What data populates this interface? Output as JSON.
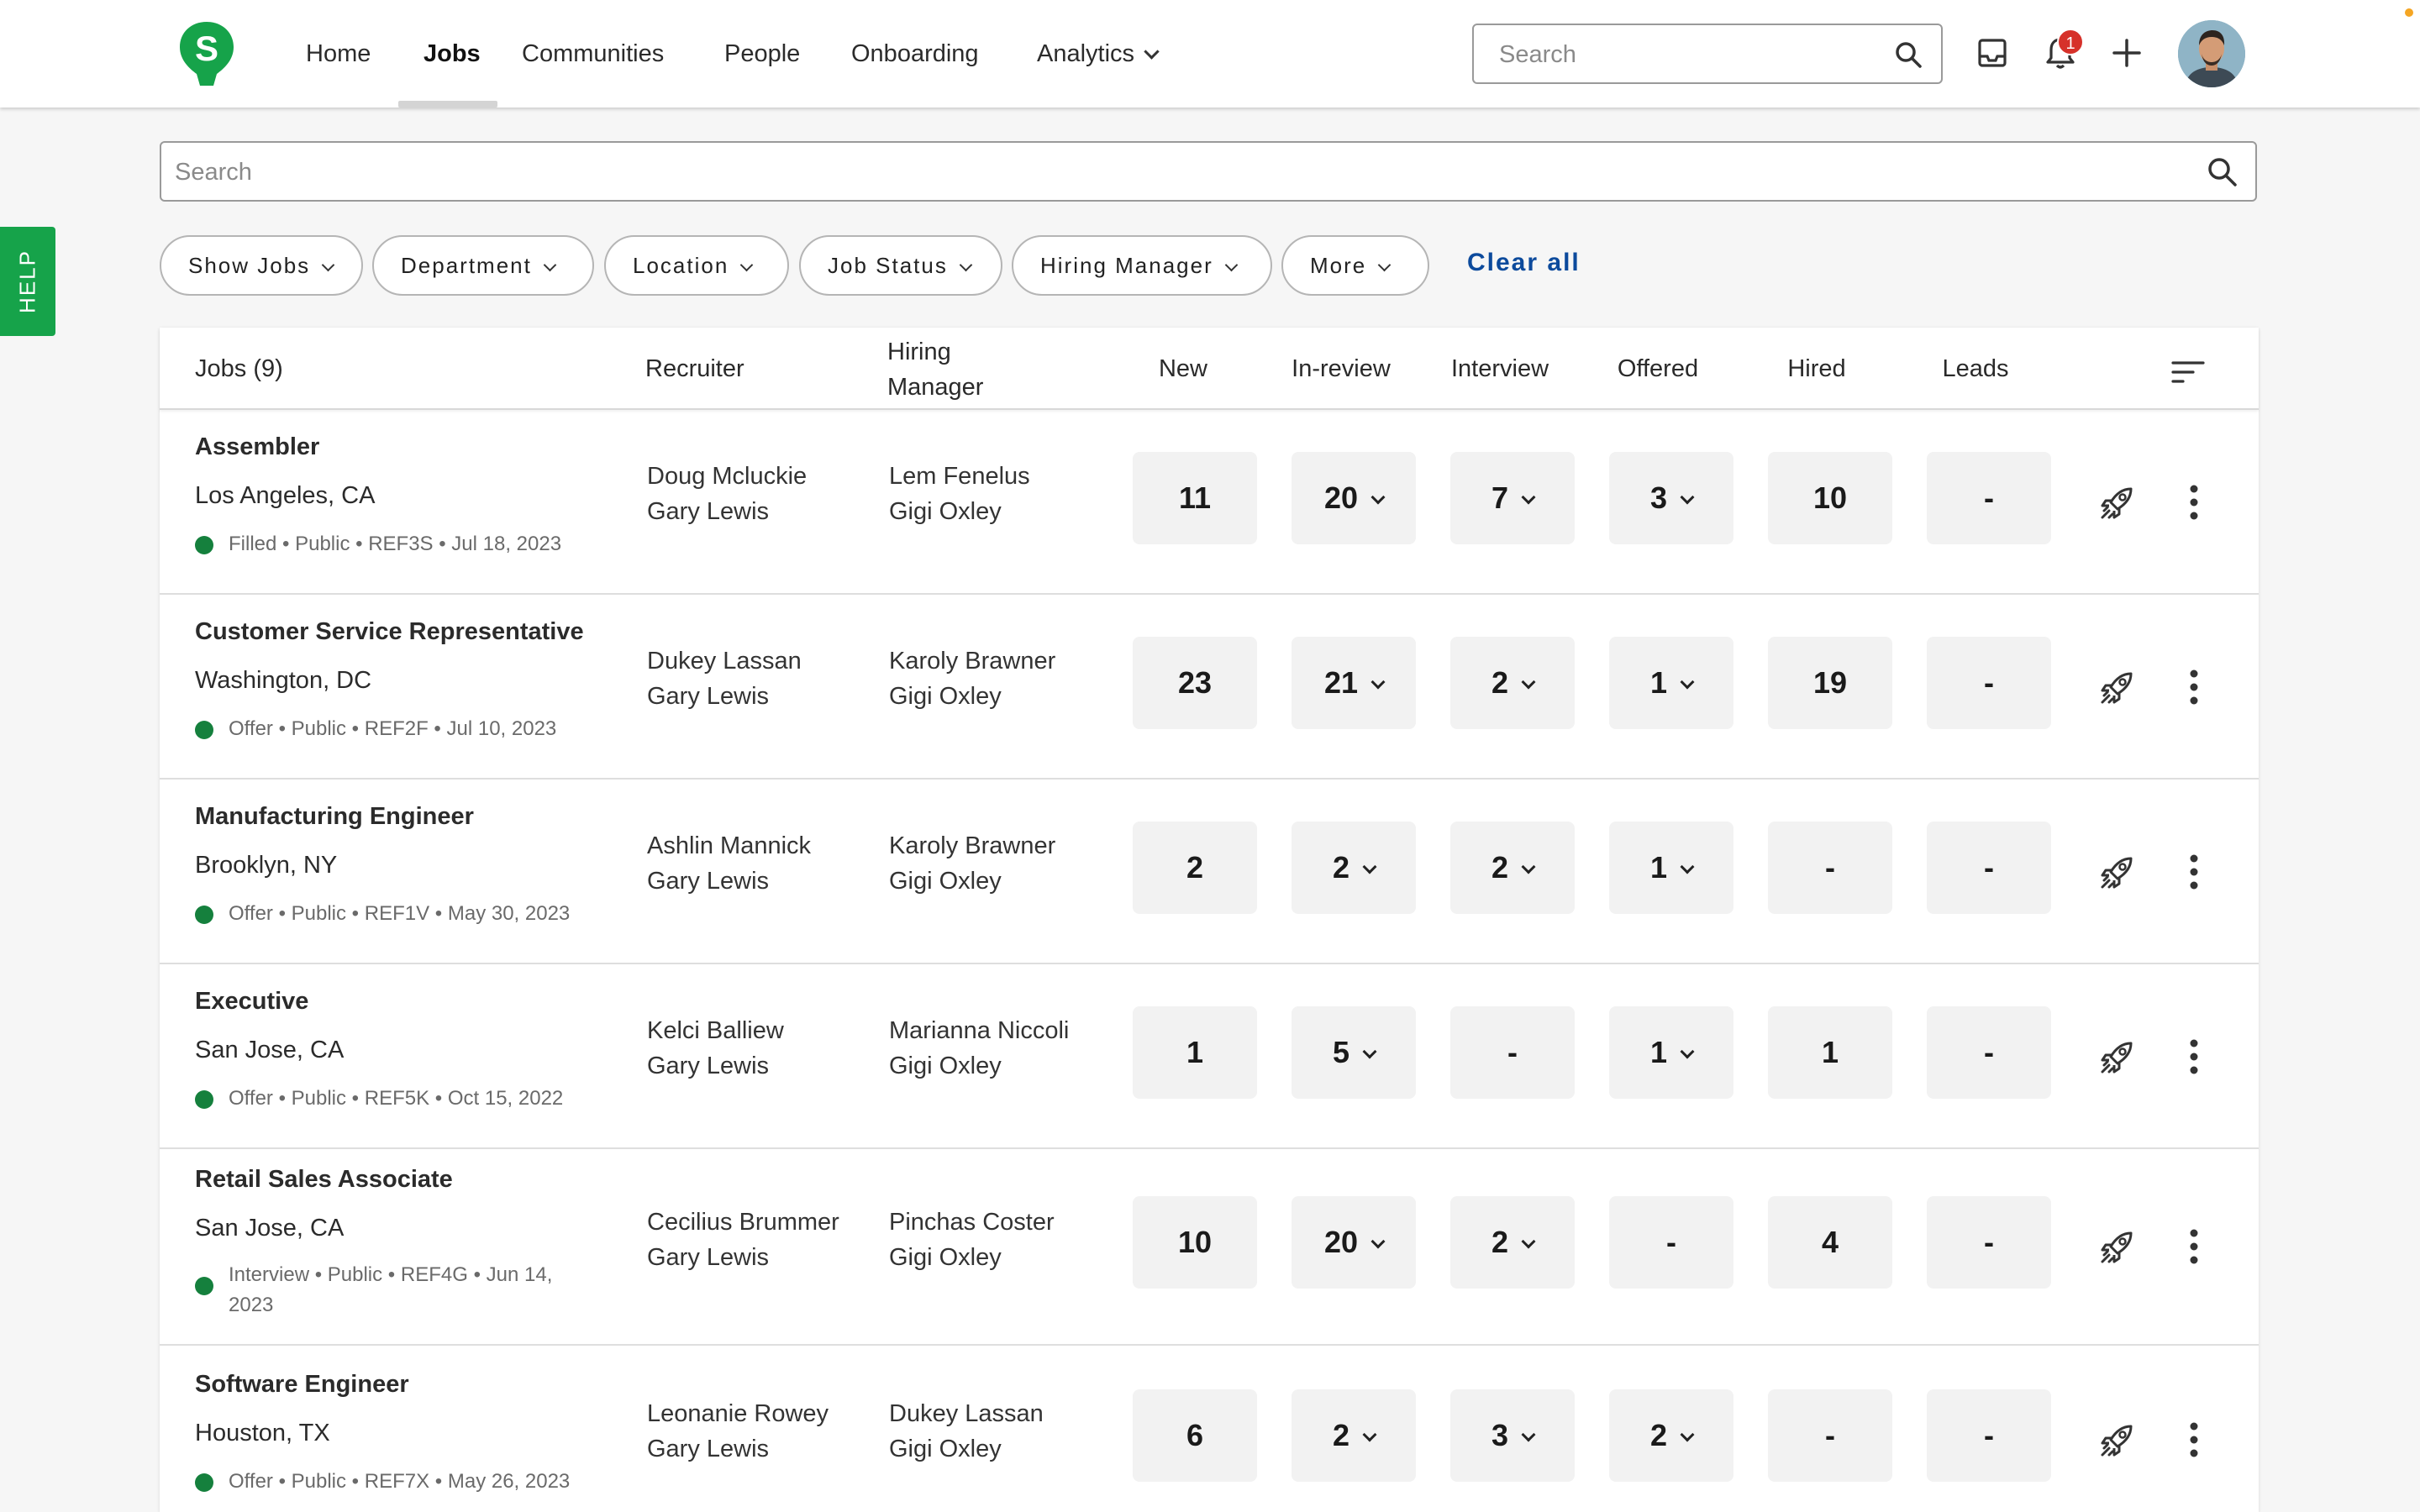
{
  "nav": {
    "items": [
      "Home",
      "Jobs",
      "Communities",
      "People",
      "Onboarding",
      "Analytics"
    ],
    "active": "Jobs",
    "search_placeholder": "Search",
    "notification_count": "1",
    "brand_color": "#16a34a"
  },
  "help_label": "HELP",
  "main_search_placeholder": "Search",
  "filters": [
    "Show Jobs",
    "Department",
    "Location",
    "Job Status",
    "Hiring Manager",
    "More"
  ],
  "clear_all_label": "Clear all",
  "table": {
    "headers": {
      "jobs": "Jobs (9)",
      "recruiter": "Recruiter",
      "hiring_manager_1": "Hiring",
      "hiring_manager_2": "Manager",
      "new": "New",
      "in_review": "In-review",
      "interview": "Interview",
      "offered": "Offered",
      "hired": "Hired",
      "leads": "Leads"
    },
    "rows": [
      {
        "title": "Assembler",
        "location": "Los Angeles, CA",
        "meta": "Filled • Public • REF3S • Jul 18, 2023",
        "recruiter": "Doug Mcluckie",
        "recruiter2": "Gary Lewis",
        "manager": "Lem Fenelus",
        "manager2": "Gigi Oxley",
        "new": "11",
        "in_review": "20",
        "interview": "7",
        "offered": "3",
        "hired": "10",
        "leads": "-"
      },
      {
        "title": "Customer Service Representative",
        "location": "Washington, DC",
        "meta": "Offer • Public • REF2F • Jul 10, 2023",
        "recruiter": "Dukey Lassan",
        "recruiter2": "Gary Lewis",
        "manager": "Karoly Brawner",
        "manager2": "Gigi Oxley",
        "new": "23",
        "in_review": "21",
        "interview": "2",
        "offered": "1",
        "hired": "19",
        "leads": "-"
      },
      {
        "title": "Manufacturing Engineer",
        "location": "Brooklyn, NY",
        "meta": "Offer • Public • REF1V • May 30, 2023",
        "recruiter": "Ashlin Mannick",
        "recruiter2": "Gary Lewis",
        "manager": "Karoly Brawner",
        "manager2": "Gigi Oxley",
        "new": "2",
        "in_review": "2",
        "interview": "2",
        "offered": "1",
        "hired": "-",
        "leads": "-"
      },
      {
        "title": "Executive",
        "location": "San Jose, CA",
        "meta": "Offer • Public • REF5K • Oct 15, 2022",
        "recruiter": "Kelci Balliew",
        "recruiter2": "Gary Lewis",
        "manager": "Marianna Niccoli",
        "manager2": "Gigi Oxley",
        "new": "1",
        "in_review": "5",
        "interview": "-",
        "offered": "1",
        "hired": "1",
        "leads": "-"
      },
      {
        "title": "Retail Sales Associate",
        "location": "San Jose, CA",
        "meta": "Interview • Public • REF4G • Jun 14, 2023",
        "recruiter": "Cecilius Brummer",
        "recruiter2": "Gary Lewis",
        "manager": "Pinchas Coster",
        "manager2": "Gigi Oxley",
        "new": "10",
        "in_review": "20",
        "interview": "2",
        "offered": "-",
        "hired": "4",
        "leads": "-"
      },
      {
        "title": "Software Engineer",
        "location": "Houston, TX",
        "meta": "Offer • Public • REF7X • May 26, 2023",
        "recruiter": "Leonanie Rowey",
        "recruiter2": "Gary Lewis",
        "manager": "Dukey Lassan",
        "manager2": "Gigi Oxley",
        "new": "6",
        "in_review": "2",
        "interview": "3",
        "offered": "2",
        "hired": "-",
        "leads": "-"
      }
    ]
  }
}
